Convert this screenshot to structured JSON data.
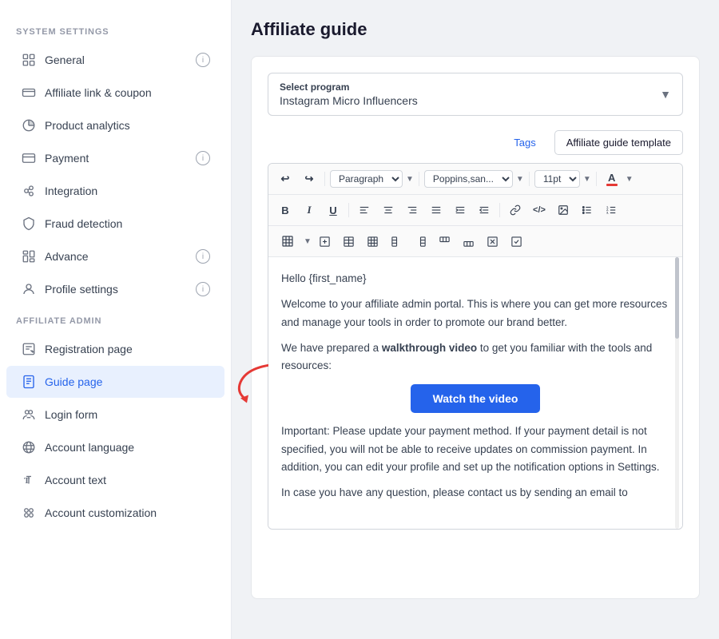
{
  "sidebar": {
    "section1_title": "SYSTEM SETTINGS",
    "section2_title": "AFFILIATE ADMIN",
    "items_system": [
      {
        "label": "General",
        "icon": "general",
        "badge": true,
        "id": "general"
      },
      {
        "label": "Affiliate link & coupon",
        "icon": "link",
        "badge": false,
        "id": "affiliate-link"
      },
      {
        "label": "Product analytics",
        "icon": "analytics",
        "badge": false,
        "id": "product-analytics"
      },
      {
        "label": "Payment",
        "icon": "payment",
        "badge": true,
        "id": "payment"
      },
      {
        "label": "Integration",
        "icon": "integration",
        "badge": false,
        "id": "integration"
      },
      {
        "label": "Fraud detection",
        "icon": "fraud",
        "badge": false,
        "id": "fraud"
      },
      {
        "label": "Advance",
        "icon": "advance",
        "badge": true,
        "id": "advance"
      },
      {
        "label": "Profile settings",
        "icon": "profile",
        "badge": true,
        "id": "profile"
      }
    ],
    "items_affiliate": [
      {
        "label": "Registration page",
        "icon": "reg",
        "badge": false,
        "id": "registration"
      },
      {
        "label": "Guide page",
        "icon": "guide",
        "badge": false,
        "id": "guide",
        "active": true
      },
      {
        "label": "Login form",
        "icon": "login",
        "badge": false,
        "id": "login"
      },
      {
        "label": "Account language",
        "icon": "language",
        "badge": false,
        "id": "language"
      },
      {
        "label": "Account text",
        "icon": "text",
        "badge": false,
        "id": "account-text"
      },
      {
        "label": "Account customization",
        "icon": "customize",
        "badge": false,
        "id": "customize"
      }
    ]
  },
  "page": {
    "title": "Affiliate guide",
    "select_program": {
      "label": "Select program",
      "value": "Instagram Micro Influencers"
    },
    "tabs": [
      {
        "label": "Tags",
        "active": false
      },
      {
        "label": "Affiliate guide template",
        "active": true
      }
    ],
    "editor": {
      "toolbar": {
        "paragraph_label": "Paragraph",
        "font_label": "Poppins,san...",
        "size_label": "11pt"
      },
      "content": {
        "greeting": "Hello {first_name}",
        "para1": "Welcome to your affiliate admin portal. This is where you can get more resources and manage your tools in order to promote our brand better.",
        "para2_prefix": "We have prepared a ",
        "para2_bold": "walkthrough video",
        "para2_suffix": " to get you familiar with the tools and resources:",
        "watch_btn": "Watch the video",
        "para3": "Important: Please update your payment method. If your payment detail is not specified, you will not be able to receive updates on commission payment. In addition, you can edit your profile and set up the notification options in Settings.",
        "para4": "In case you have any question, please contact us by sending an email to"
      }
    }
  }
}
